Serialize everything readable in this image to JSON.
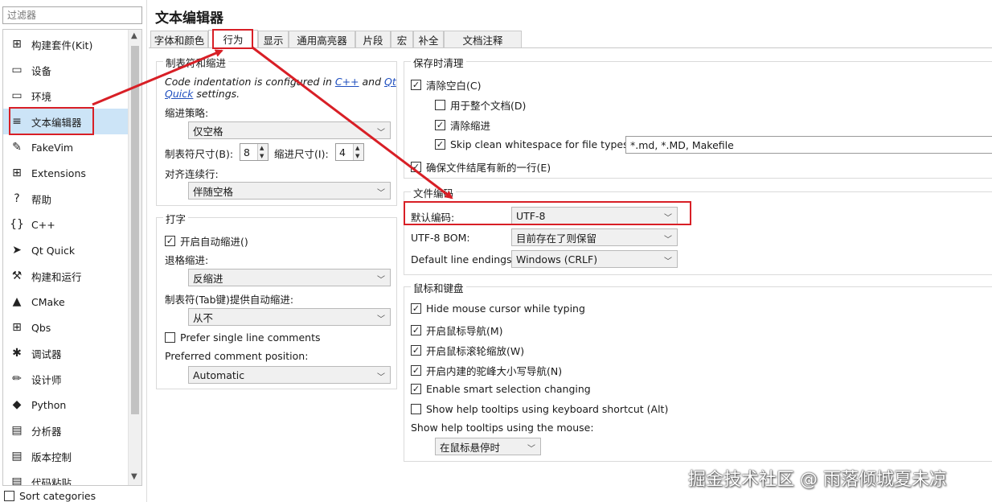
{
  "filter": {
    "placeholder": "过滤器"
  },
  "categories": [
    {
      "label": "构建套件(Kit)",
      "icon": "kit-icon",
      "glyph": "⊞"
    },
    {
      "label": "设备",
      "icon": "device-icon",
      "glyph": "▭"
    },
    {
      "label": "环境",
      "icon": "monitor-icon",
      "glyph": "▭"
    },
    {
      "label": "文本编辑器",
      "icon": "text-editor-icon",
      "glyph": "≡"
    },
    {
      "label": "FakeVim",
      "icon": "fakevim-icon",
      "glyph": "✎"
    },
    {
      "label": "Extensions",
      "icon": "extensions-icon",
      "glyph": "⊞"
    },
    {
      "label": "帮助",
      "icon": "help-icon",
      "glyph": "?"
    },
    {
      "label": "C++",
      "icon": "cpp-icon",
      "glyph": "{}"
    },
    {
      "label": "Qt Quick",
      "icon": "qtquick-icon",
      "glyph": "➤"
    },
    {
      "label": "构建和运行",
      "icon": "hammer-icon",
      "glyph": "⚒"
    },
    {
      "label": "CMake",
      "icon": "cmake-icon",
      "glyph": "▲"
    },
    {
      "label": "Qbs",
      "icon": "qbs-icon",
      "glyph": "⊞"
    },
    {
      "label": "调试器",
      "icon": "bug-icon",
      "glyph": "✱"
    },
    {
      "label": "设计师",
      "icon": "pencil-icon",
      "glyph": "✏"
    },
    {
      "label": "Python",
      "icon": "python-icon",
      "glyph": "◆"
    },
    {
      "label": "分析器",
      "icon": "analyzer-icon",
      "glyph": "▤"
    },
    {
      "label": "版本控制",
      "icon": "vcs-icon",
      "glyph": "▤"
    },
    {
      "label": "代码粘贴",
      "icon": "paste-icon",
      "glyph": "▤"
    }
  ],
  "sort_categories": {
    "label": "Sort categories",
    "checked": false
  },
  "page_title": "文本编辑器",
  "tabs": [
    "字体和颜色",
    "行为",
    "显示",
    "通用高亮器",
    "片段",
    "宏",
    "补全",
    "文档注释"
  ],
  "active_tab": "行为",
  "tabs_indent": {
    "title": "制表符和缩进",
    "note_prefix": "Code indentation is configured in ",
    "note_link1": "C++",
    "note_and": " and ",
    "note_link2a": "Qt",
    "note_link2b": "Quick",
    "note_suffix": " settings.",
    "policy_label": "缩进策略:",
    "policy_value": "仅空格",
    "tab_size_label": "制表符尺寸(B):",
    "tab_size": "8",
    "indent_size_label": "缩进尺寸(I):",
    "indent_size": "4",
    "align_label": "对齐连续行:",
    "align_value": "伴随空格"
  },
  "typing": {
    "title": "打字",
    "auto_indent_label": "开启自动缩进()",
    "auto_indent_checked": true,
    "backspace_label": "退格缩进:",
    "backspace_value": "反缩进",
    "tab_auto_label": "制表符(Tab键)提供自动缩进:",
    "tab_auto_value": "从不",
    "single_line_label": "Prefer single line comments",
    "single_line_checked": false,
    "comment_pos_label": "Preferred comment position:",
    "comment_pos_value": "Automatic"
  },
  "cleanup": {
    "title": "保存时清理",
    "clean_ws_label": "清除空白(C)",
    "clean_ws_checked": true,
    "entire_doc_label": "用于整个文档(D)",
    "entire_doc_checked": false,
    "clean_indent_label": "清除缩进",
    "clean_indent_checked": true,
    "skip_label": "Skip clean whitespace for file types:",
    "skip_checked": true,
    "skip_value": "*.md, *.MD, Makefile",
    "newline_label": "确保文件结尾有新的一行(E)",
    "newline_checked": true
  },
  "encoding": {
    "title": "文件编码",
    "default_label": "默认编码:",
    "default_value": "UTF-8",
    "bom_label": "UTF-8 BOM:",
    "bom_value": "目前存在了则保留",
    "endings_label": "Default line endings:",
    "endings_value": "Windows (CRLF)"
  },
  "mouse": {
    "title": "鼠标和键盘",
    "items": [
      {
        "label": "Hide mouse cursor while typing",
        "checked": true
      },
      {
        "label": "开启鼠标导航(M)",
        "checked": true
      },
      {
        "label": "开启鼠标滚轮缩放(W)",
        "checked": true
      },
      {
        "label": "开启内建的驼峰大小写导航(N)",
        "checked": true
      },
      {
        "label": "Enable smart selection changing",
        "checked": true
      },
      {
        "label": "Show help tooltips using keyboard shortcut (Alt)",
        "checked": false
      }
    ],
    "tooltips_label": "Show help tooltips using the mouse:",
    "tooltips_value": "在鼠标悬停时"
  },
  "watermark": "掘金技术社区 @ 雨落倾城夏未凉",
  "colors": {
    "annotation_red": "#d81f26",
    "selection_bg": "#cce4f7"
  }
}
